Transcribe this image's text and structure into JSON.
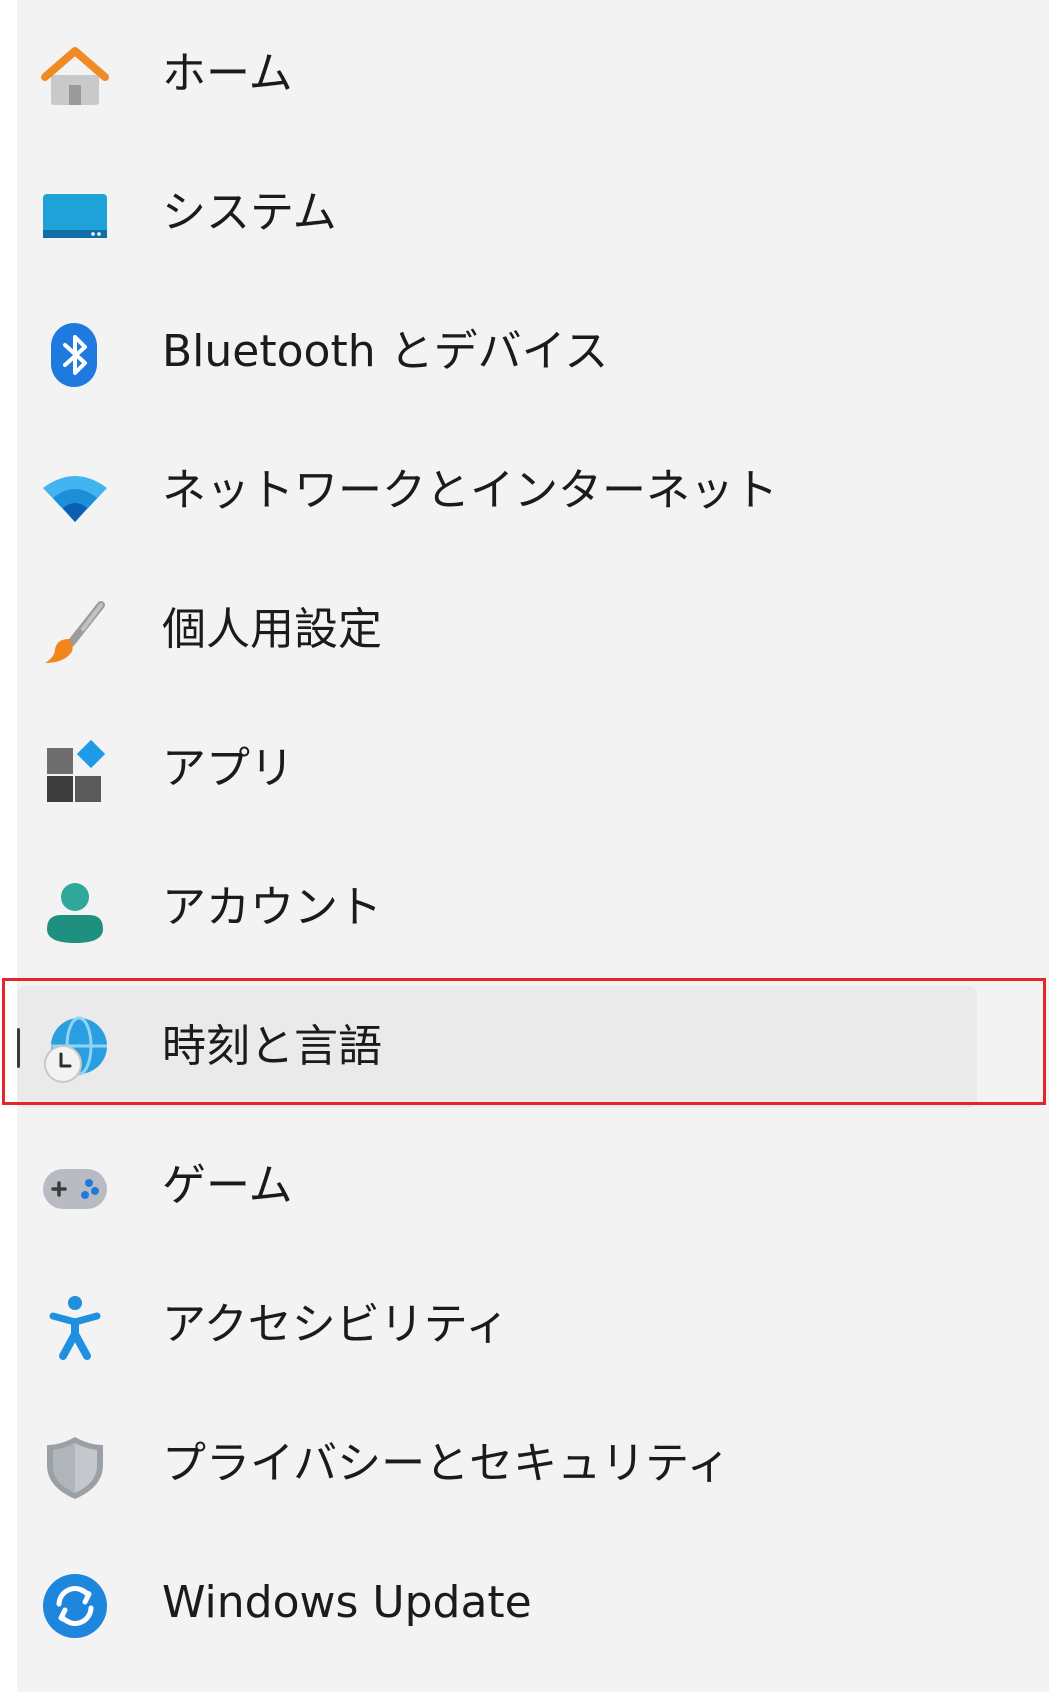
{
  "nav": {
    "items": [
      {
        "label": "ホーム",
        "icon": "home-icon",
        "selected": false
      },
      {
        "label": "システム",
        "icon": "system-icon",
        "selected": false
      },
      {
        "label": "Bluetooth とデバイス",
        "icon": "bluetooth-icon",
        "selected": false
      },
      {
        "label": "ネットワークとインターネット",
        "icon": "wifi-icon",
        "selected": false
      },
      {
        "label": "個人用設定",
        "icon": "brush-icon",
        "selected": false
      },
      {
        "label": "アプリ",
        "icon": "apps-icon",
        "selected": false
      },
      {
        "label": "アカウント",
        "icon": "account-icon",
        "selected": false
      },
      {
        "label": "時刻と言語",
        "icon": "time-language-icon",
        "selected": true
      },
      {
        "label": "ゲーム",
        "icon": "gamepad-icon",
        "selected": false
      },
      {
        "label": "アクセシビリティ",
        "icon": "accessibility-icon",
        "selected": false
      },
      {
        "label": "プライバシーとセキュリティ",
        "icon": "shield-icon",
        "selected": false
      },
      {
        "label": "Windows Update",
        "icon": "windows-update-icon",
        "selected": false
      }
    ]
  },
  "colors": {
    "nav_background": "#f3f3f3",
    "selected_background": "#eaeaea",
    "highlight_border": "#e3262c",
    "text": "#1b1b1b"
  }
}
